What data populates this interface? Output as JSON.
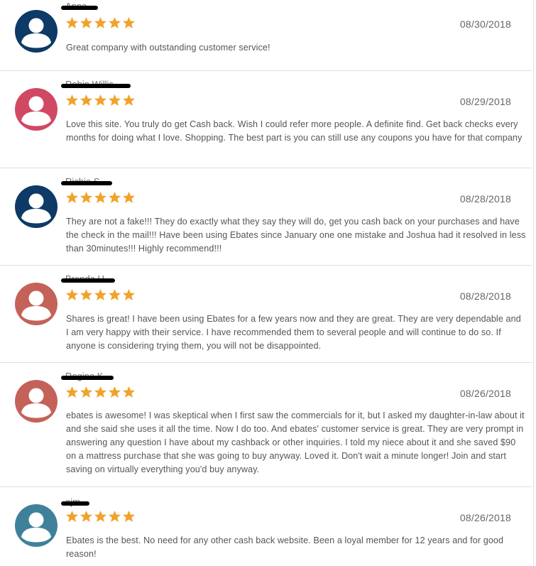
{
  "colors": {
    "star": "#f0a22a",
    "avatar_navy": "#0d3a66",
    "avatar_pink": "#d14863",
    "avatar_rose": "#c4625a",
    "avatar_teal": "#3f819a"
  },
  "reviews": [
    {
      "reviewer_name": "Anne",
      "rating": 5,
      "date": "08/30/2018",
      "text": "Great company with outstanding customer service!",
      "avatar_color": "#0d3a66",
      "icon": "user-avatar-icon"
    },
    {
      "reviewer_name": "Robin Willis",
      "rating": 5,
      "date": "08/29/2018",
      "text": "Love this site. You truly do get Cash back. Wish I could refer more people. A definite find. Get back checks every months for doing what I love. Shopping. The best part is you can still use any coupons you have for that company",
      "avatar_color": "#d14863",
      "icon": "user-avatar-icon"
    },
    {
      "reviewer_name": "Richie S.",
      "rating": 5,
      "date": "08/28/2018",
      "text": "They are not a fake!!! They do exactly what they say they will do, get you cash back on your purchases and have the check in the mail!!! Have been using Ebates since January one one mistake and Joshua had it resolved in less than 30minutes!!! Highly recommend!!!",
      "avatar_color": "#0d3a66",
      "icon": "user-avatar-icon"
    },
    {
      "reviewer_name": "Brenda H",
      "rating": 5,
      "date": "08/28/2018",
      "text": "Shares is great! I have been using Ebates for a few years now and they are great. They are very dependable and I am very happy with their service. I have recommended them to several people and will continue to do so. If anyone is considering trying them, you will not be disappointed.",
      "avatar_color": "#c4625a",
      "icon": "user-avatar-icon"
    },
    {
      "reviewer_name": "Regina K",
      "rating": 5,
      "date": "08/26/2018",
      "text": "ebates is awesome! I was skeptical when I first saw the commercials for it, but I asked my daughter-in-law about it and she said she uses it all the time. Now I do too. And ebates' customer service is great. They are very prompt in answering any question I have about my cashback or other inquiries. I told my niece about it and she saved $90 on a mattress purchase that she was going to buy anyway. Loved it. Don't wait a minute longer! Join and start saving on virtually everything you'd buy anyway.",
      "avatar_color": "#c4625a",
      "icon": "user-avatar-icon"
    },
    {
      "reviewer_name": "ajm",
      "rating": 5,
      "date": "08/26/2018",
      "text": "Ebates is the best. No need for any other cash back website. Been a loyal member for 12 years and for good reason!",
      "avatar_color": "#3f819a",
      "icon": "user-avatar-icon"
    }
  ]
}
